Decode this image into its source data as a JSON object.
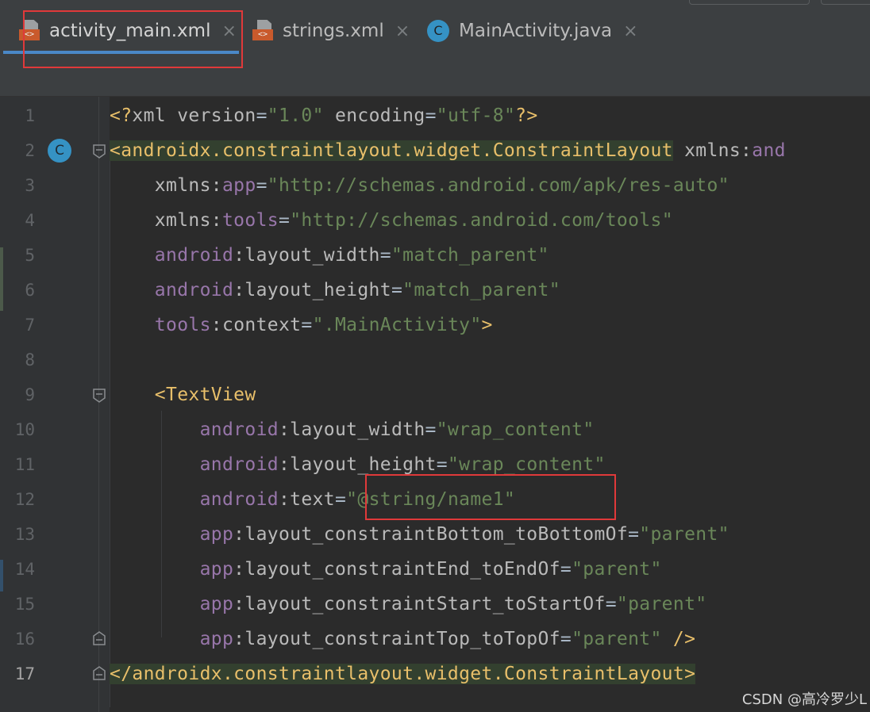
{
  "tabs": [
    {
      "label": "activity_main.xml",
      "icon": "xml-file-icon",
      "active": true
    },
    {
      "label": "strings.xml",
      "icon": "xml-file-icon",
      "active": false
    },
    {
      "label": "MainActivity.java",
      "icon": "java-class-icon",
      "active": false
    }
  ],
  "tab_close_glyph": "×",
  "tab_icon_tag": "<>",
  "class_icon_letter": "C",
  "lines": [
    {
      "num": "1"
    },
    {
      "num": "2"
    },
    {
      "num": "3"
    },
    {
      "num": "4"
    },
    {
      "num": "5"
    },
    {
      "num": "6"
    },
    {
      "num": "7"
    },
    {
      "num": "8"
    },
    {
      "num": "9"
    },
    {
      "num": "10"
    },
    {
      "num": "11"
    },
    {
      "num": "12"
    },
    {
      "num": "13"
    },
    {
      "num": "14"
    },
    {
      "num": "15"
    },
    {
      "num": "16"
    },
    {
      "num": "17"
    }
  ],
  "code": {
    "l1": {
      "open": "<?",
      "xml": "xml",
      "sp1": " ",
      "version": "version",
      "eq1": "=",
      "v1": "\"1.0\"",
      "sp2": " ",
      "encoding": "encoding",
      "eq2": "=",
      "v2": "\"utf-8\"",
      "close": "?>"
    },
    "l2": {
      "tag": "<androidx.constraintlayout.widget.ConstraintLayout",
      "sp": " ",
      "attr": "xmlns:",
      "ns": "and"
    },
    "l3": {
      "indent": "    ",
      "a": "xmlns:",
      "ns": "app",
      "eq": "=",
      "v": "\"http://schemas.android.com/apk/res-auto\""
    },
    "l4": {
      "indent": "    ",
      "a": "xmlns:",
      "ns": "tools",
      "eq": "=",
      "v": "\"http://schemas.android.com/tools\""
    },
    "l5": {
      "indent": "    ",
      "ns": "android",
      "a": ":layout_width",
      "eq": "=",
      "v": "\"match_parent\""
    },
    "l6": {
      "indent": "    ",
      "ns": "android",
      "a": ":layout_height",
      "eq": "=",
      "v": "\"match_parent\""
    },
    "l7": {
      "indent": "    ",
      "ns": "tools",
      "a": ":context",
      "eq": "=",
      "v": "\".MainActivity\"",
      "close": ">"
    },
    "l9": {
      "indent": "    ",
      "tag": "<TextView"
    },
    "l10": {
      "indent": "        ",
      "ns": "android",
      "a": ":layout_width",
      "eq": "=",
      "v": "\"wrap_content\""
    },
    "l11": {
      "indent": "        ",
      "ns": "android",
      "a": ":layout_height",
      "eq": "=",
      "v": "\"wrap_content\""
    },
    "l12": {
      "indent": "        ",
      "ns": "android",
      "a": ":text",
      "eq": "=",
      "v": "\"@string/name1\""
    },
    "l13": {
      "indent": "        ",
      "ns": "app",
      "a": ":layout_constraintBottom_toBottomOf",
      "eq": "=",
      "v": "\"parent\""
    },
    "l14": {
      "indent": "        ",
      "ns": "app",
      "a": ":layout_constraintEnd_toEndOf",
      "eq": "=",
      "v": "\"parent\""
    },
    "l15": {
      "indent": "        ",
      "ns": "app",
      "a": ":layout_constraintStart_toStartOf",
      "eq": "=",
      "v": "\"parent\""
    },
    "l16": {
      "indent": "        ",
      "ns": "app",
      "a": ":layout_constraintTop_toTopOf",
      "eq": "=",
      "v": "\"parent\"",
      "close": " />"
    },
    "l17": {
      "tag": "</androidx.constraintlayout.widget.ConstraintLayout",
      "close": ">"
    }
  },
  "watermark": "CSDN @高冷罗少L",
  "colors": {
    "editor_bg": "#2b2b2b",
    "gutter_bg": "#313335",
    "tab_bar_bg": "#3c3f41",
    "active_tab_underline": "#4a88c7",
    "tag": "#e8bf6a",
    "namespace": "#9876aa",
    "attribute": "#bababa",
    "string_value": "#6a8759",
    "highlight_box": "#e0393a"
  }
}
